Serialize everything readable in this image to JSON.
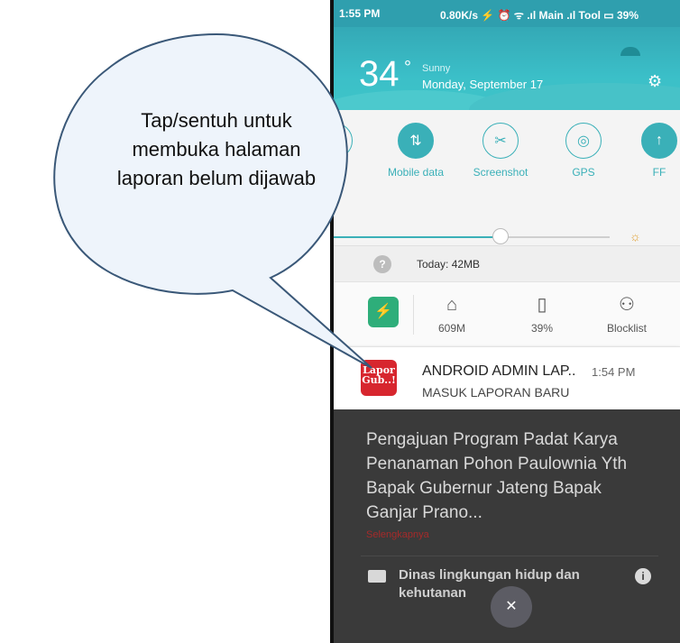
{
  "status_bar": {
    "time": "1:55 PM",
    "info": "0.80K/s ⚡ ⏰ ᯤ .ıl Main .ıl Tool ▭ 39%"
  },
  "weather": {
    "temperature": "34",
    "degree": "°",
    "condition": "Sunny",
    "date": "Monday, September 17"
  },
  "quick_toggles": [
    {
      "label": "",
      "icon": "wifi-icon",
      "on": false
    },
    {
      "label": "Mobile data",
      "icon": "mobile-data-icon",
      "on": true
    },
    {
      "label": "Screenshot",
      "icon": "scissors-icon",
      "on": false
    },
    {
      "label": "GPS",
      "icon": "gps-icon",
      "on": false
    },
    {
      "label": "FF",
      "icon": "toggle-icon",
      "on": true
    }
  ],
  "brightness": {
    "level": 0.5
  },
  "data_usage": {
    "text": "Today: 42MB"
  },
  "security": {
    "memory": "609M",
    "battery": "39%",
    "blocklist": "Blocklist"
  },
  "notification": {
    "app_icon_text": "Lapor Gub..!",
    "title": "ANDROID ADMIN LAP..",
    "time": "1:54 PM",
    "body": "MASUK LAPORAN BARU"
  },
  "background_app": {
    "text": "Pengajuan Program Padat Karya Penanaman Pohon Paulownia Yth Bapak Gubernur Jateng Bapak Ganjar Prano...",
    "link": "Selengkapnya",
    "category": "Dinas lingkungan hidup dan kehutanan"
  },
  "callout": {
    "text": "Tap/sentuh untuk membuka halaman laporan belum dijawab"
  },
  "colors": {
    "accent": "#3ab0b8",
    "app_red": "#d7262e",
    "shield_green": "#2eae7a"
  }
}
